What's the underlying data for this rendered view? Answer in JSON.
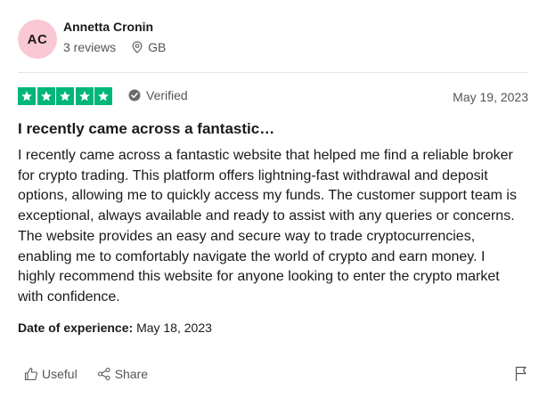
{
  "reviewer": {
    "initials": "AC",
    "name": "Annetta Cronin",
    "reviews": "3 reviews",
    "location": "GB",
    "avatar_color": "#f9c8d4"
  },
  "rating": {
    "stars": 5,
    "star_color": "#00b67a",
    "verified_label": "Verified",
    "date": "May 19, 2023"
  },
  "review": {
    "title": "I recently came across a fantastic…",
    "body": "I recently came across a fantastic website that helped me find a reliable broker for crypto trading. This platform offers lightning-fast withdrawal and deposit options, allowing me to quickly access my funds. The customer support team is exceptional, always available and ready to assist with any queries or concerns. The website provides an easy and secure way to trade cryptocurrencies, enabling me to comfortably navigate the world of crypto and earn money. I highly recommend this website for anyone looking to enter the crypto market with confidence.",
    "experience_label": "Date of experience:",
    "experience_date": "May 18, 2023"
  },
  "actions": {
    "useful_label": "Useful",
    "share_label": "Share",
    "useful_icon": "thumbs-up-icon",
    "share_icon": "share-icon",
    "flag_icon": "flag-icon"
  }
}
